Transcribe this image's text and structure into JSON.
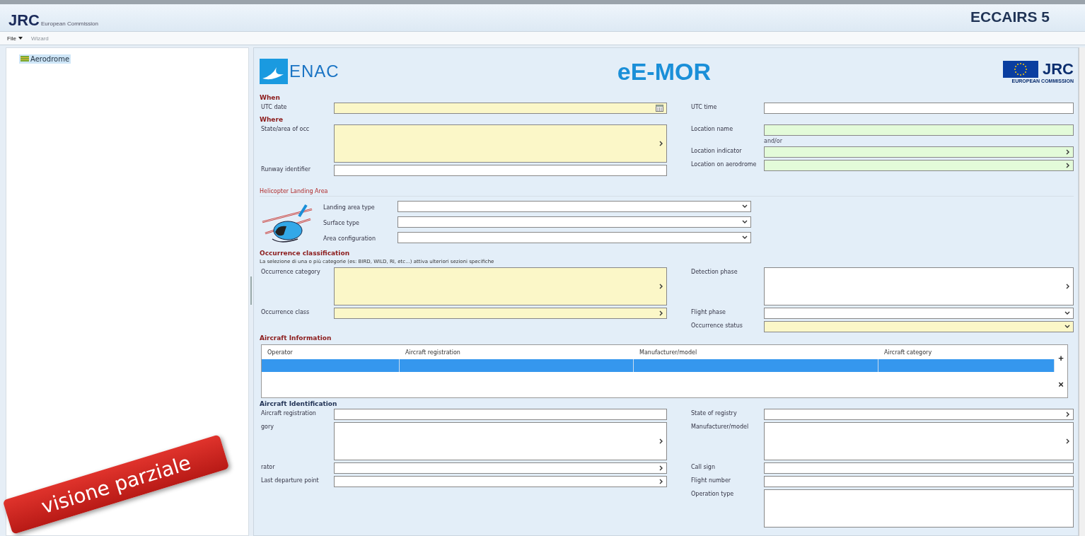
{
  "header": {
    "logo": "JRC",
    "org": "European Commission",
    "product": "ECCAIRS 5"
  },
  "menu": [
    {
      "label": "File",
      "disabled": false
    },
    {
      "label": "Wizard",
      "disabled": true
    }
  ],
  "tree": [
    {
      "label": "Aerodrome",
      "selected": true
    }
  ],
  "form": {
    "brand_left": "ENAC",
    "title": "eE-MOR",
    "brand_right": "JRC",
    "brand_right_sub": "EUROPEAN COMMISSION",
    "sections": [
      {
        "kind": "fields",
        "title": "When",
        "left": [
          {
            "label": "UTC date",
            "kind": "date",
            "color": "#fbf7c8"
          }
        ],
        "right": [
          {
            "label": "UTC time",
            "kind": "text",
            "color": "#ffffff"
          }
        ]
      },
      {
        "kind": "fields",
        "title": "Where",
        "left": [
          {
            "label": "State/area of occ",
            "kind": "picker",
            "color": "#fbf7c8",
            "tall": true
          },
          {
            "label": "Runway identifier",
            "kind": "text",
            "color": "#ffffff"
          }
        ],
        "right": [
          {
            "label": "Location name",
            "kind": "text",
            "color": "#e3fbd9"
          },
          {
            "label": "and/or",
            "kind": "note"
          },
          {
            "label": "Location indicator",
            "kind": "picker",
            "color": "#e3fbd9"
          },
          {
            "label": "Location on aerodrome",
            "kind": "picker",
            "color": "#e3fbd9"
          }
        ]
      },
      {
        "kind": "helicopter",
        "title": "Helicopter Landing Area",
        "fields": [
          {
            "label": "Landing area type"
          },
          {
            "label": "Surface type"
          },
          {
            "label": "Area configuration"
          }
        ]
      },
      {
        "kind": "fields",
        "title": "Occurrence classification",
        "note": "La selezione di una o più categorie (es: BIRD, WILD, RI, etc...) attiva ulteriori sezioni specifiche",
        "left": [
          {
            "label": "Occurrence category",
            "kind": "picker",
            "color": "#fbf7c8",
            "tall": true
          },
          {
            "label": "Occurrence class",
            "kind": "picker",
            "color": "#fbf7c8"
          }
        ],
        "right": [
          {
            "label": "Detection phase",
            "kind": "picker",
            "color": "#ffffff",
            "tall": true
          },
          {
            "label": "Flight phase",
            "kind": "select",
            "color": "#ffffff"
          },
          {
            "label": "Occurrence status",
            "kind": "select",
            "color": "#fbf7c8"
          }
        ]
      },
      {
        "kind": "table",
        "title": "Aircraft Information",
        "columns": [
          "Operator",
          "Aircraft registration",
          "Manufacturer/model",
          "Aircraft category"
        ],
        "rows": [
          {
            "selected": true
          }
        ],
        "add": "+",
        "remove": "×"
      },
      {
        "kind": "fields",
        "title": "Aircraft Identification",
        "left": [
          {
            "label": "Aircraft registration",
            "kind": "text"
          },
          {
            "label": "gory",
            "kind": "picker",
            "tall": true
          },
          {
            "label": "rator",
            "kind": "picker"
          },
          {
            "label": "Last departure point",
            "kind": "picker"
          }
        ],
        "right": [
          {
            "label": "State of registry",
            "kind": "picker"
          },
          {
            "label": "Manufacturer/model",
            "kind": "picker",
            "tall": true
          },
          {
            "label": "Call sign",
            "kind": "text"
          },
          {
            "label": "Flight number",
            "kind": "text"
          },
          {
            "label": "Operation type",
            "kind": "text",
            "tall": true
          }
        ]
      }
    ]
  },
  "ribbon": "visione parziale"
}
